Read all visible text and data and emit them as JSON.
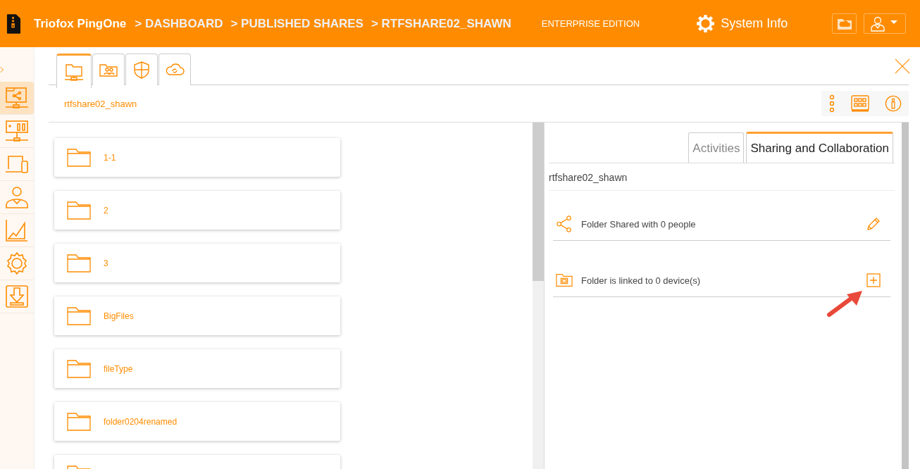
{
  "header": {
    "app_name": "Triofox PingOne",
    "breadcrumbs": [
      "> DASHBOARD",
      "> PUBLISHED SHARES",
      "> RTFSHARE02_SHAWN"
    ],
    "edition": "ENTERPRISE EDITION",
    "system_info": "System Info"
  },
  "sidebar": {
    "items": [
      {
        "kind": "share",
        "selected": true
      },
      {
        "kind": "server",
        "selected": false
      },
      {
        "kind": "devices",
        "selected": false
      },
      {
        "kind": "user",
        "selected": false
      },
      {
        "kind": "chart",
        "selected": false
      },
      {
        "kind": "settings",
        "selected": false
      },
      {
        "kind": "download",
        "selected": false
      }
    ]
  },
  "tabs": [
    {
      "kind": "folder",
      "selected": true
    },
    {
      "kind": "users",
      "selected": false
    },
    {
      "kind": "shield",
      "selected": false
    },
    {
      "kind": "cloud",
      "selected": false
    }
  ],
  "path": "rtfshare02_shawn",
  "folders": [
    {
      "kind": "folder",
      "name": "1-1"
    },
    {
      "kind": "folder",
      "name": "2"
    },
    {
      "kind": "folder",
      "name": "3"
    },
    {
      "kind": "folder",
      "name": "BigFiles"
    },
    {
      "kind": "folder",
      "name": "fileType"
    },
    {
      "kind": "folder",
      "name": "folder0204renamed"
    },
    {
      "kind": "folder"
    }
  ],
  "details": {
    "tabs": [
      {
        "label": "Activities",
        "selected": false
      },
      {
        "label": "Sharing and Collaboration",
        "selected": true
      }
    ],
    "title": "rtfshare02_shawn",
    "rows": [
      {
        "kind": "share",
        "text": "Folder Shared with 0 people"
      },
      {
        "kind": "device",
        "text": "Folder is linked to 0 device(s)"
      }
    ]
  }
}
